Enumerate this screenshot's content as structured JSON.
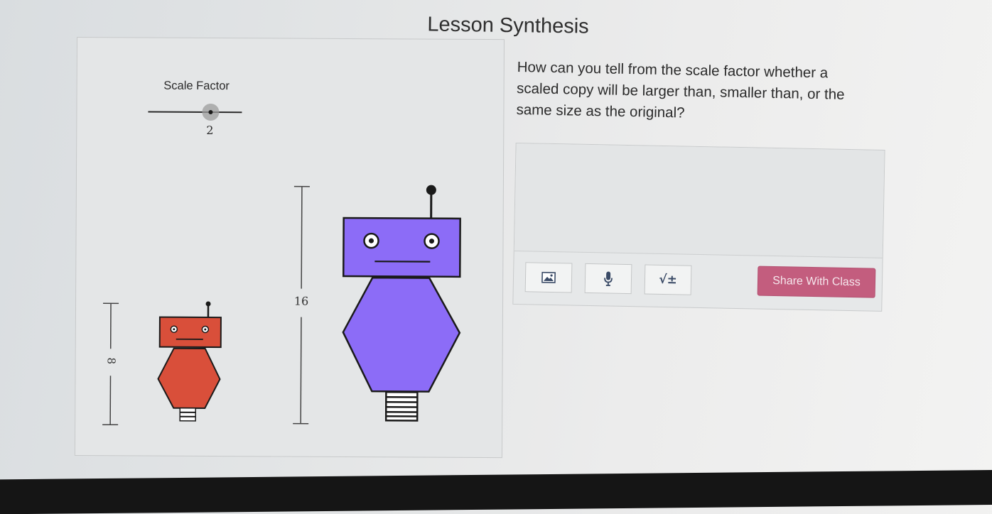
{
  "lesson": {
    "title": "Lesson Synthesis"
  },
  "graph": {
    "slider_label": "Scale Factor",
    "slider_value": "2",
    "small_height_label": "8",
    "large_height_label": "16",
    "colors": {
      "original_robot": "#d94f3a",
      "scaled_robot": "#8c6cf7",
      "outline": "#1a1a1a"
    }
  },
  "question": {
    "prompt": "How can you tell from the scale factor whether a scaled copy will be larger than, smaller than, or the same size as the original?"
  },
  "response": {
    "input_value": "",
    "toolbar": {
      "image_icon": "image-icon",
      "mic_icon": "microphone-icon",
      "math_icon": "math-icon",
      "math_glyph": "√±"
    },
    "share_label": "Share With Class",
    "share_color": "#c35d7e"
  }
}
